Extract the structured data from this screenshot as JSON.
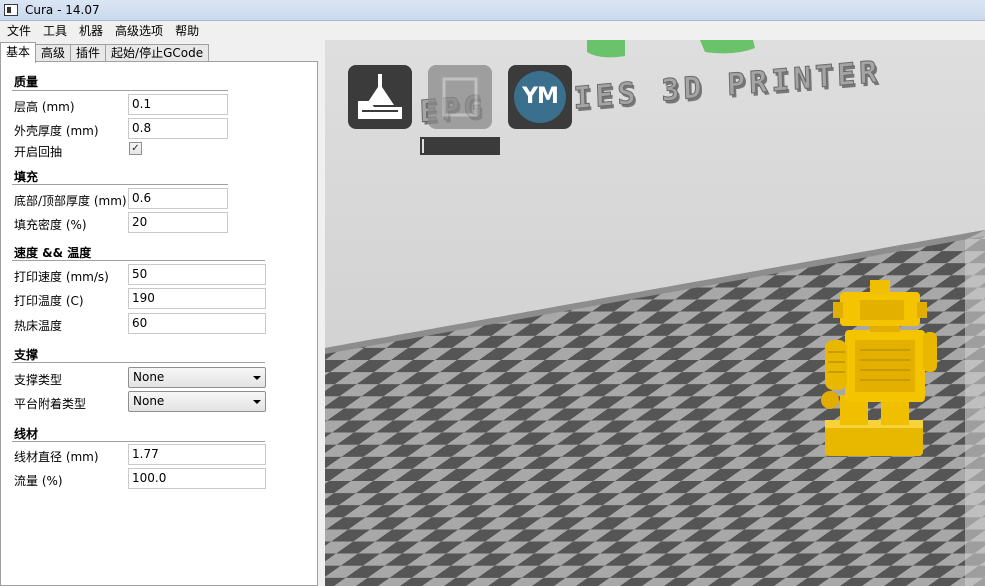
{
  "window": {
    "title": "Cura - 14.07"
  },
  "menubar": {
    "items": [
      "文件",
      "工具",
      "机器",
      "高级选项",
      "帮助"
    ]
  },
  "tabs": [
    "基本",
    "高级",
    "插件",
    "起始/停止GCode"
  ],
  "sections": {
    "quality": {
      "title": "质量",
      "layer_height_label": "层高 (mm)",
      "layer_height_value": "0.1",
      "shell_thickness_label": "外壳厚度 (mm)",
      "shell_thickness_value": "0.8",
      "retraction_label": "开启回抽",
      "retraction_checked": "✓"
    },
    "fill": {
      "title": "填充",
      "bottom_top_label": "底部/顶部厚度 (mm)",
      "bottom_top_value": "0.6",
      "density_label": "填充密度 (%)",
      "density_value": "20"
    },
    "speed": {
      "title": "速度 && 温度",
      "print_speed_label": "打印速度 (mm/s)",
      "print_speed_value": "50",
      "print_temp_label": "打印温度 (C)",
      "print_temp_value": "190",
      "bed_temp_label": "热床温度",
      "bed_temp_value": "60"
    },
    "support": {
      "title": "支撑",
      "support_type_label": "支撑类型",
      "support_type_value": "None",
      "adhesion_label": "平台附着类型",
      "adhesion_value": "None"
    },
    "filament": {
      "title": "线材",
      "diameter_label": "线材直径 (mm)",
      "diameter_value": "1.77",
      "flow_label": "流量 (%)",
      "flow_value": "100.0"
    }
  },
  "viewport": {
    "tool_ym_label": "YM",
    "printer_text": "EPG SERIES 3D PRINTER",
    "colors": {
      "background": "#dcdcdc",
      "checker_dark": "#555555",
      "checker_light": "#a8a8a8",
      "model": "#f5c400"
    }
  }
}
